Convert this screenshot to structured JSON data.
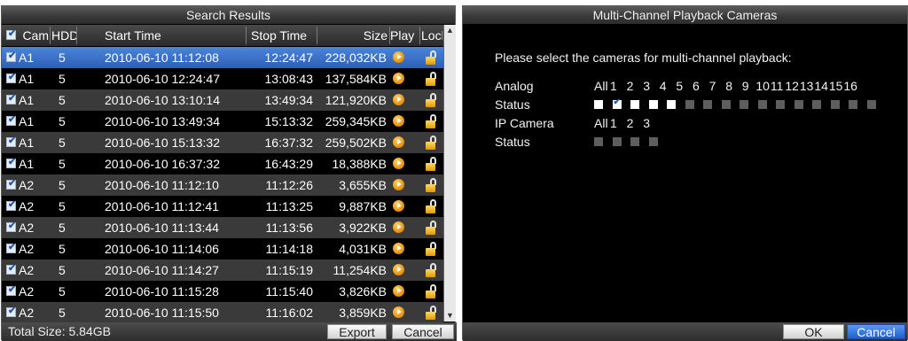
{
  "search_results": {
    "title": "Search Results",
    "columns": {
      "cam": "Cam",
      "hdd": "HDD",
      "start": "Start Time",
      "stop": "Stop Time",
      "size": "Size",
      "play": "Play",
      "lock": "Lock"
    },
    "rows": [
      {
        "cam": "A1",
        "hdd": "5",
        "start": "2010-06-10 11:12:08",
        "stop": "12:24:47",
        "size": "228,032KB",
        "selected": true
      },
      {
        "cam": "A1",
        "hdd": "5",
        "start": "2010-06-10 12:24:47",
        "stop": "13:08:43",
        "size": "137,584KB",
        "selected": false
      },
      {
        "cam": "A1",
        "hdd": "5",
        "start": "2010-06-10 13:10:14",
        "stop": "13:49:34",
        "size": "121,920KB",
        "selected": false
      },
      {
        "cam": "A1",
        "hdd": "5",
        "start": "2010-06-10 13:49:34",
        "stop": "15:13:32",
        "size": "259,345KB",
        "selected": false
      },
      {
        "cam": "A1",
        "hdd": "5",
        "start": "2010-06-10 15:13:32",
        "stop": "16:37:32",
        "size": "259,502KB",
        "selected": false
      },
      {
        "cam": "A1",
        "hdd": "5",
        "start": "2010-06-10 16:37:32",
        "stop": "16:43:29",
        "size": "18,388KB",
        "selected": false
      },
      {
        "cam": "A2",
        "hdd": "5",
        "start": "2010-06-10 11:12:10",
        "stop": "11:12:26",
        "size": "3,655KB",
        "selected": false
      },
      {
        "cam": "A2",
        "hdd": "5",
        "start": "2010-06-10 11:12:41",
        "stop": "11:13:25",
        "size": "9,887KB",
        "selected": false
      },
      {
        "cam": "A2",
        "hdd": "5",
        "start": "2010-06-10 11:13:44",
        "stop": "11:13:56",
        "size": "3,922KB",
        "selected": false
      },
      {
        "cam": "A2",
        "hdd": "5",
        "start": "2010-06-10 11:14:06",
        "stop": "11:14:18",
        "size": "4,031KB",
        "selected": false
      },
      {
        "cam": "A2",
        "hdd": "5",
        "start": "2010-06-10 11:14:27",
        "stop": "11:15:19",
        "size": "11,254KB",
        "selected": false
      },
      {
        "cam": "A2",
        "hdd": "5",
        "start": "2010-06-10 11:15:28",
        "stop": "11:15:40",
        "size": "3,826KB",
        "selected": false
      },
      {
        "cam": "A2",
        "hdd": "5",
        "start": "2010-06-10 11:15:50",
        "stop": "11:16:02",
        "size": "3,859KB",
        "selected": false
      }
    ],
    "total_size": "Total Size: 5.84GB",
    "export_label": "Export",
    "cancel_label": "Cancel"
  },
  "playback": {
    "title": "Multi-Channel Playback Cameras",
    "prompt": "Please select the cameras for multi-channel playback:",
    "analog_label": "Analog",
    "status_label": "Status",
    "ip_camera_label": "IP Camera",
    "ip_status_label": "Status",
    "all_label": "All",
    "analog_channels": [
      "1",
      "2",
      "3",
      "4",
      "5",
      "6",
      "7",
      "8",
      "9",
      "10",
      "11",
      "12",
      "13",
      "14",
      "15",
      "16"
    ],
    "analog_status": [
      "white",
      "checked",
      "white",
      "white",
      "white",
      "gray",
      "gray",
      "gray",
      "gray",
      "gray",
      "gray",
      "gray",
      "gray",
      "gray",
      "gray",
      "gray"
    ],
    "ip_channels": [
      "1",
      "2",
      "3"
    ],
    "ip_status": [
      "gray",
      "gray",
      "gray",
      "gray"
    ],
    "ok_label": "OK",
    "cancel_label": "Cancel"
  },
  "colors": {
    "selected_row": "#3a6fc4",
    "even_row": "#3a3a3a",
    "odd_row": "#000000",
    "accent_blue": "#1f5fce"
  }
}
